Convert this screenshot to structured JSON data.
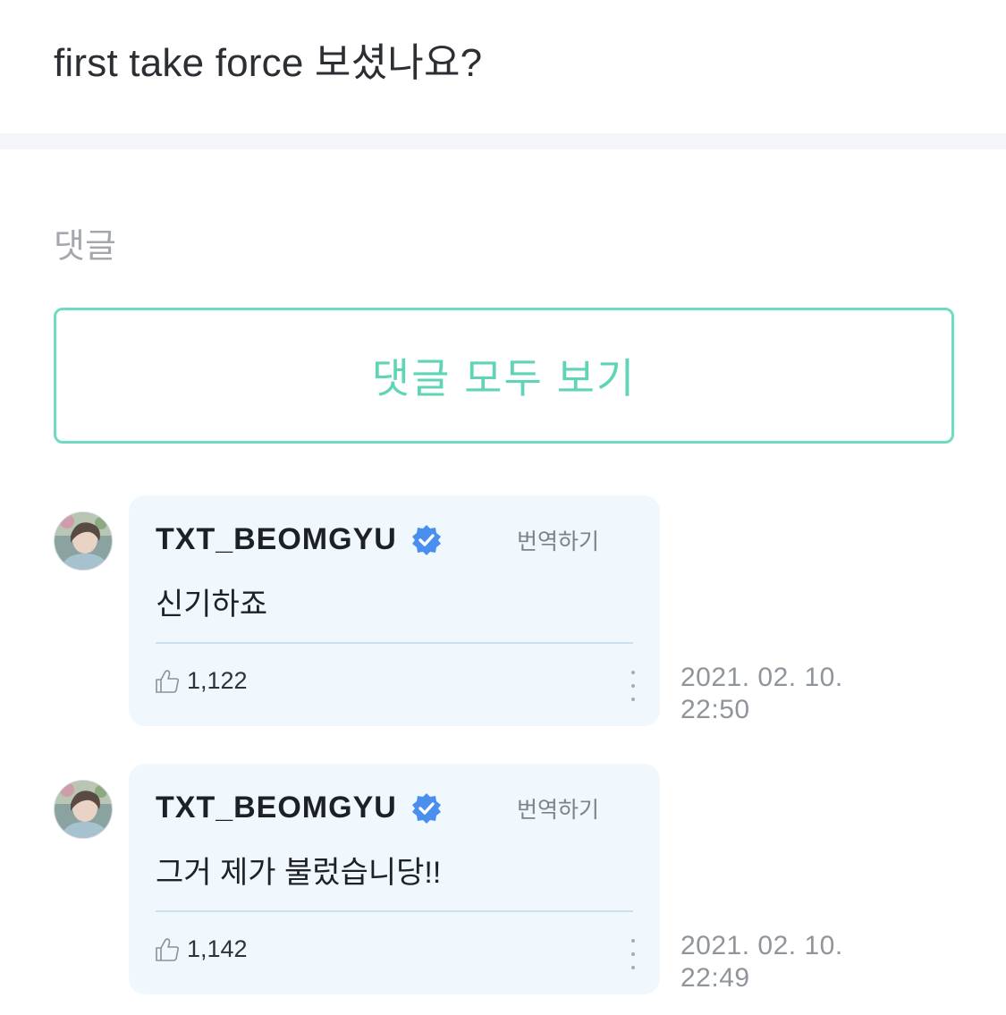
{
  "post": {
    "text": "first take force 보셨나요?"
  },
  "comments_section": {
    "title": "댓글",
    "view_all_label": "댓글 모두 보기"
  },
  "colors": {
    "accent": "#5fd4b7",
    "bubble": "#f0f8fd",
    "verified": "#4a8ff0"
  },
  "comments": [
    {
      "username": "TXT_BEOMGYU",
      "verified_icon": "verified-badge-icon",
      "translate_label": "번역하기",
      "text": "신기하죠",
      "likes": "1,122",
      "date": "2021. 02. 10.",
      "time": "22:50"
    },
    {
      "username": "TXT_BEOMGYU",
      "verified_icon": "verified-badge-icon",
      "translate_label": "번역하기",
      "text": "그거 제가 불렀습니당!!",
      "likes": "1,142",
      "date": "2021. 02. 10.",
      "time": "22:49"
    }
  ]
}
